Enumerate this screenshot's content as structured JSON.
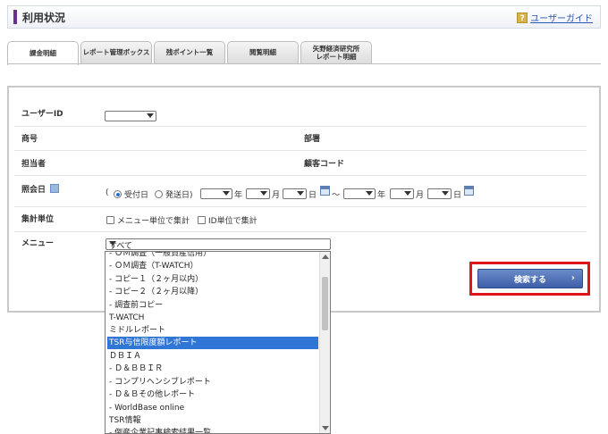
{
  "header": {
    "title": "利用状況",
    "guide_label": "ユーザーガイド",
    "guide_icon": "?"
  },
  "tabs": [
    {
      "label": "課金明細",
      "active": true
    },
    {
      "label": "レポート管理ボックス",
      "active": false
    },
    {
      "label": "残ポイント一覧",
      "active": false
    },
    {
      "label": "閲覧明細",
      "active": false
    },
    {
      "label": "矢野経済研究所\nレポート明細",
      "active": false
    }
  ],
  "form": {
    "user_id_label": "ユーザーID",
    "company_label": "商号",
    "department_label": "部署",
    "person_label": "担当者",
    "customer_code_label": "顧客コード",
    "inquiry_date_label": "照会日",
    "paren_open": "(",
    "received_label": "受付日",
    "sent_label": "発送日)",
    "year": "年",
    "month": "月",
    "day": "日",
    "tilde": "〜",
    "aggregation_label": "集計単位",
    "agg_menu_label": "メニュー単位で集計",
    "agg_id_label": "ID単位で集計",
    "menu_label": "メニュー",
    "menu_selected": "すべて"
  },
  "search_button_label": "検索する",
  "dropdown_items": [
    "- ＯＭ調査（一般資産信用）",
    "- ＯＭ調査（T-WATCH）",
    "- コピー１（２ヶ月以内）",
    "- コピー２（２ヶ月以降）",
    "- 調査前コピー",
    "T-WATCH",
    "ミドルレポート",
    "TSR与信限度額レポート",
    "ＤＢＩＡ",
    "- Ｄ＆ＢＢＩＲ",
    "- コンプリヘンシブレポート",
    "- Ｄ＆Ｂその他レポート",
    "- WorldBase online",
    "TSR情報",
    "- 倒産企業記事検索結果一覧"
  ],
  "highlighted_item_index": 7,
  "colors": {
    "accent": "#6b2f8f",
    "highlight": "#2f76d6",
    "button": "#3d5ea8",
    "outline": "#e0141b"
  }
}
